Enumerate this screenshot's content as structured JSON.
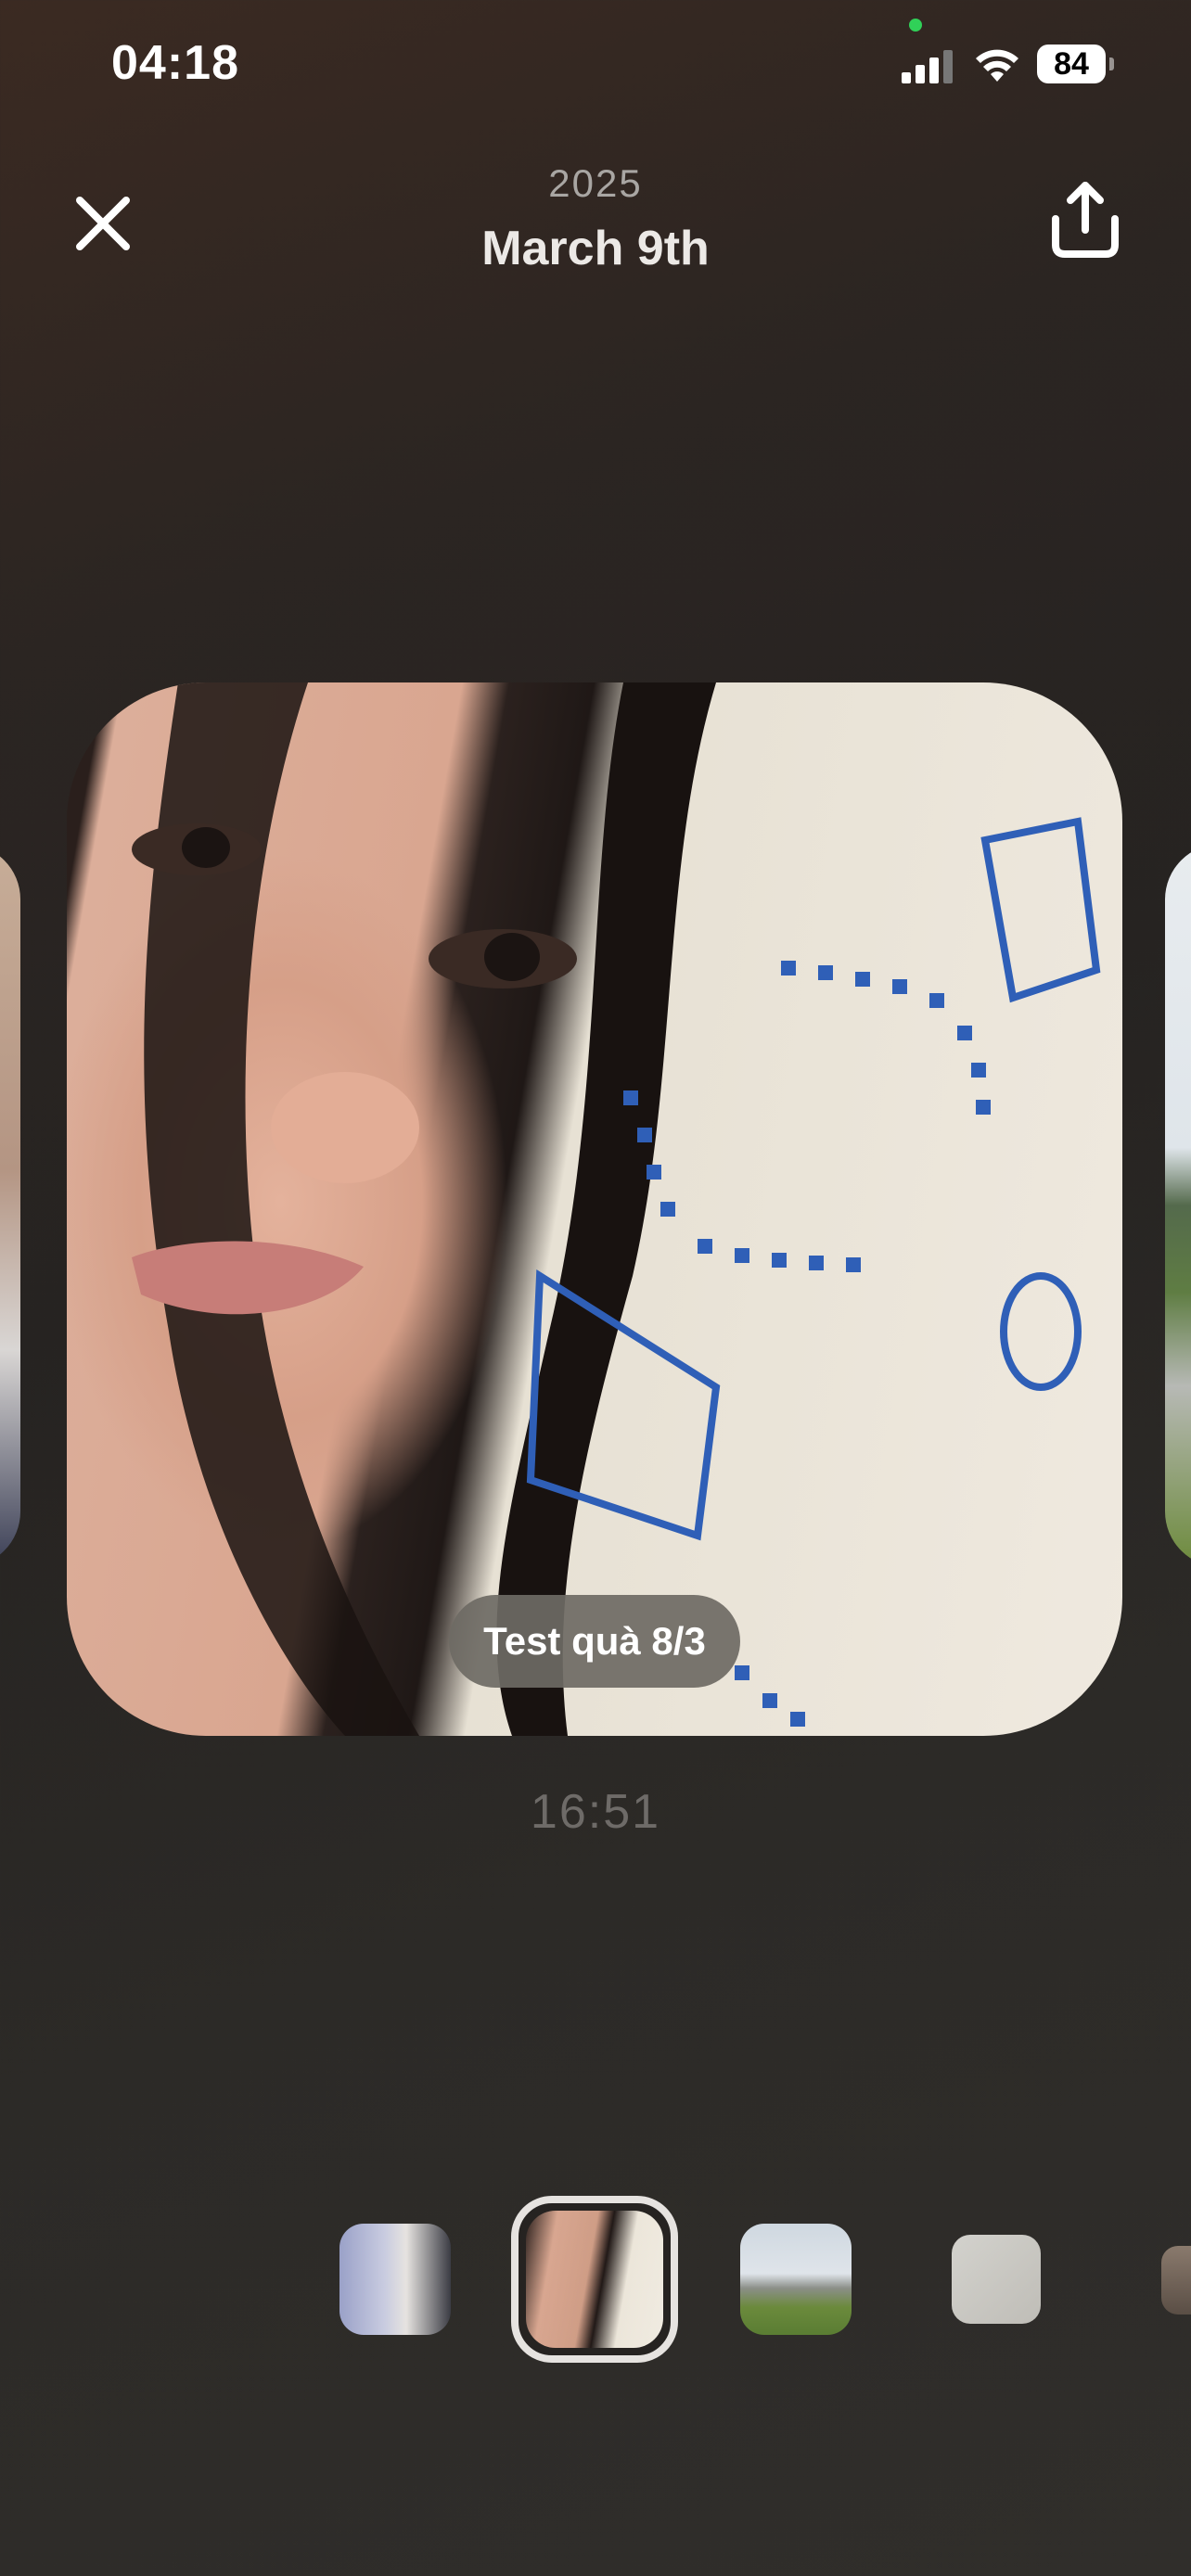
{
  "status_bar": {
    "time": "04:18",
    "battery": "84",
    "signal_icon": "cellular-signal-icon",
    "wifi_icon": "wifi-icon",
    "privacy_dot_color": "#30d158"
  },
  "header": {
    "year": "2025",
    "date": "March 9th",
    "close_icon": "close-icon",
    "share_icon": "share-icon"
  },
  "photo": {
    "caption": "Test quà 8/3",
    "time": "16:51"
  },
  "thumbnails": [
    {
      "label": "photo-desk",
      "selected": false
    },
    {
      "label": "photo-selfie",
      "selected": true
    },
    {
      "label": "photo-mausoleum",
      "selected": false
    },
    {
      "label": "photo-document",
      "selected": false
    },
    {
      "label": "photo-partial",
      "selected": false
    }
  ]
}
